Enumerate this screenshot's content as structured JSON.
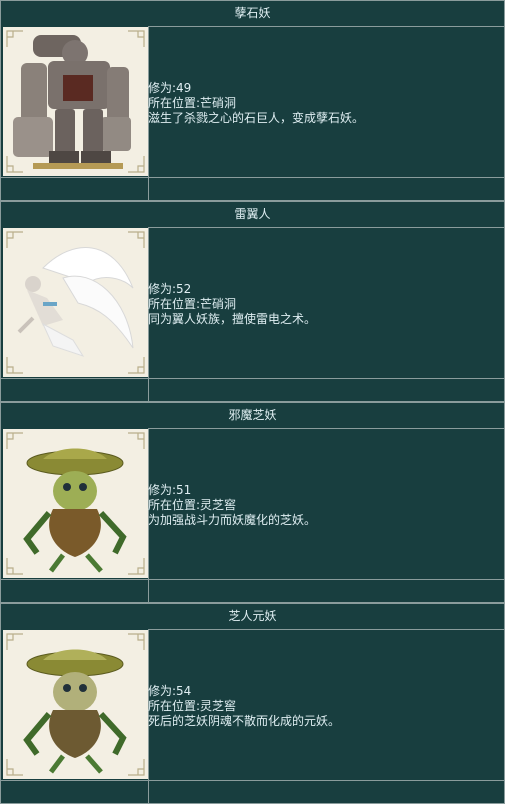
{
  "monsters": [
    {
      "name": "孽石妖",
      "level": "修为:49",
      "location": "所在位置:芒硝洞",
      "desc": "滋生了杀戮之心的石巨人，变成孽石妖。",
      "image": "stone-golem-portrait"
    },
    {
      "name": "雷翼人",
      "level": "修为:52",
      "location": "所在位置:芒硝洞",
      "desc": "同为翼人妖族，擅使雷电之术。",
      "image": "winged-thunder-man-portrait"
    },
    {
      "name": "邪魔芝妖",
      "level": "修为:51",
      "location": "所在位置:灵芝窖",
      "desc": "为加强战斗力而妖魔化的芝妖。",
      "image": "mushroom-demon-portrait"
    },
    {
      "name": "芝人元妖",
      "level": "修为:54",
      "location": "所在位置:灵芝窖",
      "desc": "死后的芝妖阴魂不散而化成的元妖。",
      "image": "mushroom-spirit-portrait"
    }
  ]
}
